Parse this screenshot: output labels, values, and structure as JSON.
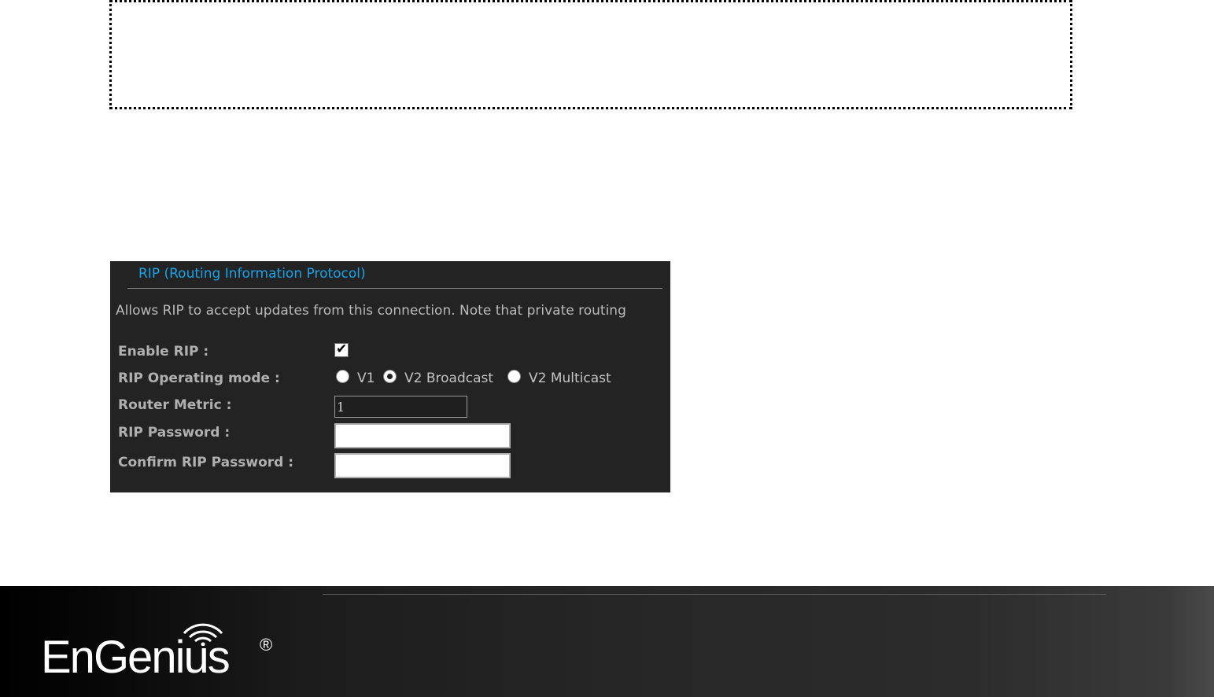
{
  "rip_panel": {
    "title": "RIP (Routing Information Protocol)",
    "description": "Allows RIP to accept updates from this connection. Note that private routing",
    "enable_label": "Enable RIP :",
    "enable_checked": true,
    "mode_label": "RIP Operating mode :",
    "mode_options": [
      {
        "label": "V1",
        "selected": false
      },
      {
        "label": "V2 Broadcast",
        "selected": true
      },
      {
        "label": "V2 Multicast",
        "selected": false
      }
    ],
    "metric_label": "Router Metric :",
    "metric_value": "1",
    "password_label": "RIP Password :",
    "password_value": "",
    "confirm_label": "Confirm RIP Password :",
    "confirm_value": ""
  },
  "footer": {
    "brand": "EnGenius",
    "registered_mark": "®"
  },
  "colors": {
    "panel_bg": "#232323",
    "title_accent": "#1aa3e8"
  }
}
